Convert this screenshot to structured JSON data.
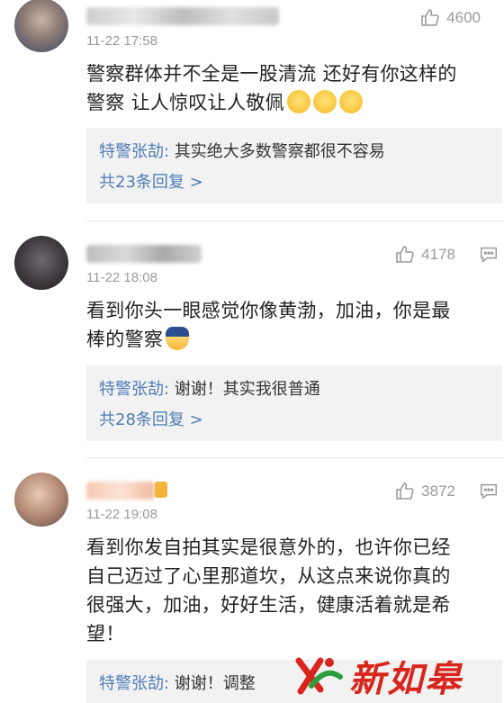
{
  "comments": [
    {
      "time": "11-22 17:58",
      "likes": "4600",
      "text_line1": "警察群体并不全是一股清流 还好有你这样的",
      "text_line2": "警察 让人惊叹让人敬佩",
      "reply": {
        "author": "特警张劼:",
        "text": " 其实绝大多数警察都很不容易"
      },
      "more": "共23条回复 >"
    },
    {
      "time": "11-22 18:08",
      "likes": "4178",
      "text_line1": "看到你头一眼感觉你像黄渤，加油，你是最",
      "text_line2": "棒的警察",
      "reply": {
        "author": "特警张劼:",
        "text": " 谢谢！其实我很普通"
      },
      "more": "共28条回复 >"
    },
    {
      "time": "11-22 19:08",
      "likes": "3872",
      "text_line1": "看到你发自拍其实是很意外的，也许你已经",
      "text_line2": "自己迈过了心里那道坎，从这点来说你真的",
      "text_line3": "很强大，加油，好好生活，健康活着就是希",
      "text_line4": "望！",
      "reply": {
        "author": "特警张劼:",
        "text": " 谢谢！调整"
      }
    }
  ],
  "watermark": {
    "text": "新如皋"
  }
}
